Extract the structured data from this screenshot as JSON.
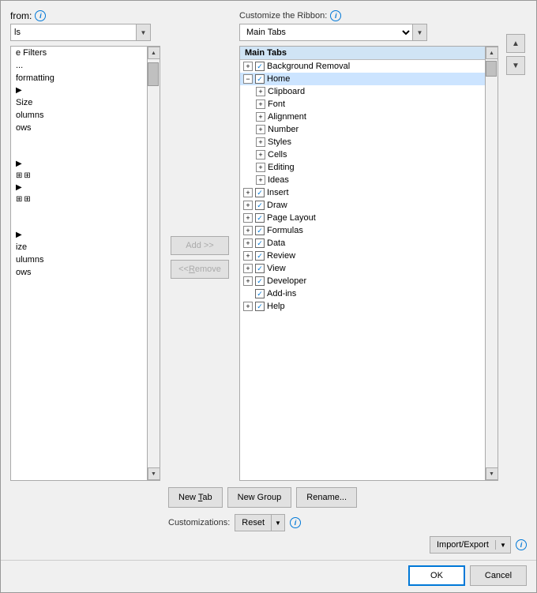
{
  "left": {
    "from_label": "from:",
    "from_dropdown": "ls",
    "filter_label": "e Filters",
    "filter_item": "...",
    "formatting_label": "formatting",
    "size_label": "Size",
    "columns_label": "olumns",
    "rows_label": "ows",
    "size2_label": "ize",
    "columns2_label": "ulumns",
    "rows2_label": "ows"
  },
  "middle": {
    "add_btn": "Add >>",
    "remove_btn": "<< Remove"
  },
  "right": {
    "customize_label": "Customize the Ribbon:",
    "main_tabs_dropdown": "Main Tabs",
    "tree": [
      {
        "id": "bg",
        "indent": 1,
        "expand": true,
        "checked": true,
        "label": "Background Removal"
      },
      {
        "id": "home",
        "indent": 1,
        "expand": true,
        "checked": true,
        "label": "Home",
        "selected": true
      },
      {
        "id": "clipboard",
        "indent": 2,
        "expand": true,
        "checked": false,
        "label": "Clipboard"
      },
      {
        "id": "font",
        "indent": 2,
        "expand": true,
        "checked": false,
        "label": "Font"
      },
      {
        "id": "alignment",
        "indent": 2,
        "expand": true,
        "checked": false,
        "label": "Alignment"
      },
      {
        "id": "number",
        "indent": 2,
        "expand": true,
        "checked": false,
        "label": "Number"
      },
      {
        "id": "styles",
        "indent": 2,
        "expand": true,
        "checked": false,
        "label": "Styles"
      },
      {
        "id": "cells",
        "indent": 2,
        "expand": true,
        "checked": false,
        "label": "Cells"
      },
      {
        "id": "editing",
        "indent": 2,
        "expand": true,
        "checked": false,
        "label": "Editing"
      },
      {
        "id": "ideas",
        "indent": 2,
        "expand": true,
        "checked": false,
        "label": "Ideas"
      },
      {
        "id": "insert",
        "indent": 1,
        "expand": true,
        "checked": true,
        "label": "Insert"
      },
      {
        "id": "draw",
        "indent": 1,
        "expand": true,
        "checked": true,
        "label": "Draw"
      },
      {
        "id": "pagelayout",
        "indent": 1,
        "expand": true,
        "checked": true,
        "label": "Page Layout"
      },
      {
        "id": "formulas",
        "indent": 1,
        "expand": true,
        "checked": true,
        "label": "Formulas"
      },
      {
        "id": "data",
        "indent": 1,
        "expand": true,
        "checked": true,
        "label": "Data"
      },
      {
        "id": "review",
        "indent": 1,
        "expand": true,
        "checked": true,
        "label": "Review"
      },
      {
        "id": "view",
        "indent": 1,
        "expand": true,
        "checked": true,
        "label": "View"
      },
      {
        "id": "developer",
        "indent": 1,
        "expand": true,
        "checked": true,
        "label": "Developer"
      },
      {
        "id": "addins",
        "indent": 1,
        "expand": false,
        "checked": true,
        "label": "Add-ins"
      },
      {
        "id": "help",
        "indent": 1,
        "expand": true,
        "checked": true,
        "label": "Help"
      }
    ],
    "new_tab_btn": "New Tab",
    "new_group_btn": "New Group",
    "rename_btn": "Rename...",
    "customizations_label": "Customizations:",
    "reset_btn": "Reset",
    "import_export_btn": "Import/Export"
  },
  "footer": {
    "ok_btn": "OK",
    "cancel_btn": "Cancel"
  }
}
